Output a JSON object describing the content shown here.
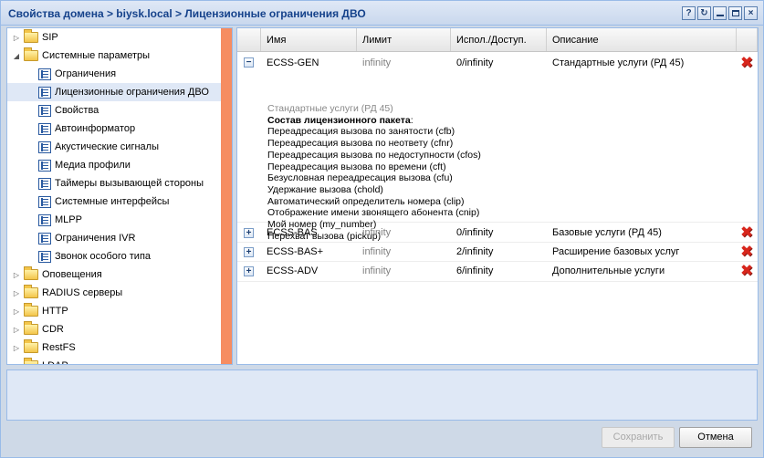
{
  "window": {
    "title": "Свойства домена > biysk.local > Лицензионные ограничения ДВО",
    "tools": [
      "?",
      "↻",
      "—",
      "□",
      "×"
    ]
  },
  "tree": {
    "items": [
      {
        "label": "SIP",
        "type": "folder",
        "expanded": false,
        "level": 0
      },
      {
        "label": "Системные параметры",
        "type": "folder",
        "expanded": true,
        "level": 0
      },
      {
        "label": "Ограничения",
        "type": "leaf",
        "level": 1
      },
      {
        "label": "Лицензионные ограничения ДВО",
        "type": "leaf",
        "level": 1,
        "selected": true
      },
      {
        "label": "Свойства",
        "type": "leaf",
        "level": 1
      },
      {
        "label": "Автоинформатор",
        "type": "leaf",
        "level": 1
      },
      {
        "label": "Акустические сигналы",
        "type": "leaf",
        "level": 1
      },
      {
        "label": "Медиа профили",
        "type": "leaf",
        "level": 1
      },
      {
        "label": "Таймеры вызывающей стороны",
        "type": "leaf",
        "level": 1
      },
      {
        "label": "Системные интерфейсы",
        "type": "leaf",
        "level": 1
      },
      {
        "label": "MLPP",
        "type": "leaf",
        "level": 1
      },
      {
        "label": "Ограничения IVR",
        "type": "leaf",
        "level": 1
      },
      {
        "label": "Звонок особого типа",
        "type": "leaf",
        "level": 1
      },
      {
        "label": "Оповещения",
        "type": "folder",
        "expanded": false,
        "level": 0
      },
      {
        "label": "RADIUS серверы",
        "type": "folder",
        "expanded": false,
        "level": 0
      },
      {
        "label": "HTTP",
        "type": "folder",
        "expanded": false,
        "level": 0
      },
      {
        "label": "CDR",
        "type": "folder",
        "expanded": false,
        "level": 0
      },
      {
        "label": "RestFS",
        "type": "folder",
        "expanded": false,
        "level": 0
      },
      {
        "label": "LDAP",
        "type": "folder",
        "expanded": false,
        "level": 0
      }
    ]
  },
  "grid": {
    "columns": [
      "Имя",
      "Лимит",
      "Испол./Доступ.",
      "Описание"
    ],
    "rows": [
      {
        "name": "ECSS-GEN",
        "limit": "infinity",
        "usage": "0/infinity",
        "description": "Стандартные услуги (РД 45)",
        "expander": "−",
        "details": {
          "subtitle": "Стандартные услуги (РД 45)",
          "heading": "Состав лицензионного пакета",
          "heading_suffix": ":",
          "lines": [
            "Переадресация вызова по занятости (cfb)",
            "Переадресация вызова по неответу (cfnr)",
            "Переадресация вызова по недоступности (cfos)",
            "Переадресация вызова по времени (cft)",
            "Безусловная переадресация вызова (cfu)",
            "Удержание вызова (chold)",
            "Автоматический определитель номера (clip)",
            "Отображение имени звонящего абонента (cnip)",
            "Мой номер (my_number)",
            "Перехват вызова (pickup)"
          ]
        }
      },
      {
        "name": "ECSS-BAS",
        "limit": "infinity",
        "usage": "0/infinity",
        "description": "Базовые услуги (РД 45)",
        "expander": "+"
      },
      {
        "name": "ECSS-BAS+",
        "limit": "infinity",
        "usage": "2/infinity",
        "description": "Расширение базовых услуг",
        "expander": "+"
      },
      {
        "name": "ECSS-ADV",
        "limit": "infinity",
        "usage": "6/infinity",
        "description": "Дополнительные услуги",
        "expander": "+"
      }
    ]
  },
  "buttons": {
    "save": "Сохранить",
    "cancel": "Отмена"
  },
  "colors": {
    "accent": "#15428b",
    "scroll_strip": "#f68d61",
    "delete": "#d8261c"
  }
}
